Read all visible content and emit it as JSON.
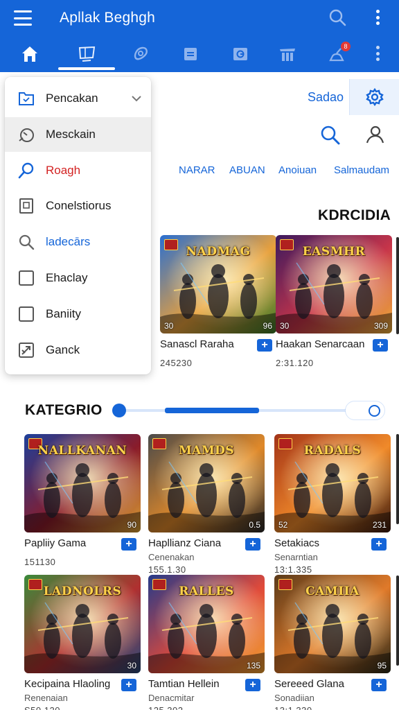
{
  "app": {
    "title": "Apllak Beghgh"
  },
  "tabs": [
    {
      "icon": "home-icon",
      "active": true
    },
    {
      "icon": "monitor-icon",
      "active": false
    },
    {
      "icon": "controller-icon",
      "active": false
    },
    {
      "icon": "category-icon",
      "active": false
    },
    {
      "icon": "store-icon",
      "active": false
    },
    {
      "icon": "ranking-icon",
      "active": false
    },
    {
      "icon": "notification-icon",
      "active": false,
      "badge": "8"
    },
    {
      "icon": "more-icon",
      "active": false
    }
  ],
  "header": {
    "right_label": "Sadao"
  },
  "filters": [
    "NARAR",
    "ABUAN",
    "Anoiuan",
    "Salmaudam"
  ],
  "dropdown": {
    "items": [
      {
        "label": "Pencakan",
        "icon": "folder-icon",
        "color": "#1b1b1b",
        "expandable": true
      },
      {
        "label": "Mesckain",
        "icon": "timer-icon",
        "color": "#1b1b1b",
        "highlighted": true
      },
      {
        "label": "Roagh",
        "icon": "search-icon",
        "color": "#d32222"
      },
      {
        "label": "Conelstiorus",
        "icon": "document-icon",
        "color": "#1b1b1b"
      },
      {
        "label": "ladecārs",
        "icon": "magnifier-icon",
        "color": "#1565d8"
      },
      {
        "label": "Ehaclay",
        "icon": "checkbox-icon",
        "color": "#1b1b1b"
      },
      {
        "label": "Baniity",
        "icon": "checkbox-icon",
        "color": "#1b1b1b"
      },
      {
        "label": "Ganck",
        "icon": "tools-icon",
        "color": "#1b1b1b"
      }
    ]
  },
  "section1": {
    "title": "KDRCIDIA",
    "cards": [
      {
        "name": "Sanascl Raraha",
        "meta": "245230",
        "art_title": "NADMAG",
        "left": "30",
        "right": "96",
        "palette": [
          "#2a6fd0",
          "#e8a03c",
          "#3b7a2a"
        ]
      },
      {
        "name": "Haakan Senarcaan",
        "meta": "2:31.120",
        "art_title": "EASMHR",
        "left": "30",
        "right": "309",
        "palette": [
          "#3b1a5e",
          "#c7354a",
          "#f0b23a"
        ]
      }
    ]
  },
  "section2": {
    "title": "KATEGRIO",
    "slider_value": 0.42,
    "cards": [
      {
        "name": "Papliiy Gama",
        "meta": "151130",
        "art_title": "NALLKANAN",
        "left": "",
        "right": "90",
        "palette": [
          "#1d3f9a",
          "#8a1c2a",
          "#d9a035"
        ]
      },
      {
        "name": "Hapllianz Ciana",
        "sub": "Cenenakan",
        "meta": "155.1.30",
        "art_title": "MAMDS",
        "left": "",
        "right": "0.5",
        "palette": [
          "#4a4a4a",
          "#e0892a",
          "#2a2a2a"
        ]
      },
      {
        "name": "Setakiacs",
        "sub": "Senarntian",
        "meta": "13:1.335",
        "art_title": "RADALS",
        "left": "52",
        "right": "231",
        "palette": [
          "#a23318",
          "#f08a2a",
          "#3a1a10"
        ]
      },
      {
        "name": "Kecipaina Hlaoling",
        "sub": "Renenaian",
        "meta": "S50.120",
        "art_title": "LADNOLRS",
        "left": "",
        "right": "30",
        "palette": [
          "#3a8a3a",
          "#b03030",
          "#2a4a7a"
        ]
      },
      {
        "name": "Tamtian Hellein",
        "sub": "Denacmitar",
        "meta": "125.302",
        "art_title": "RALLES",
        "left": "",
        "right": "135",
        "palette": [
          "#253a8a",
          "#e04a3a",
          "#f0a030"
        ]
      },
      {
        "name": "Sereeed Glana",
        "sub": "Sonadiian",
        "meta": "13:1.330",
        "art_title": "CAMIIA",
        "left": "",
        "right": "95",
        "palette": [
          "#5a3a1a",
          "#e07a2a",
          "#2a2a1a"
        ]
      }
    ]
  },
  "colors": {
    "primary": "#1565d8",
    "danger": "#d32222",
    "surface": "#ffffff"
  }
}
